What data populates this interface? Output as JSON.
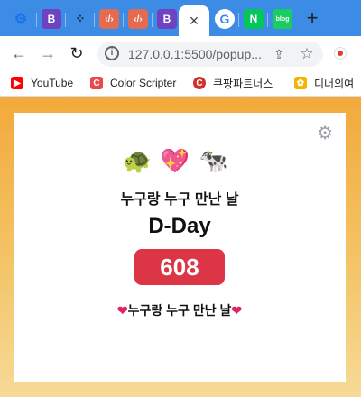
{
  "browser": {
    "tab_labels": [
      "B",
      "B"
    ],
    "active_tab_close": "×",
    "new_tab": "+",
    "address": "127.0.0.1:5500/popup...",
    "bookmarks": [
      "YouTube",
      "Color Scripter",
      "쿠팡파트너스",
      "디너의여"
    ]
  },
  "app": {
    "emojis": "🐢💖🐄",
    "title": "누구랑 누구 만난 날",
    "heading": "D-Day",
    "count": "608",
    "subtitle": "누구랑 누구 만난 날",
    "heart": "❤"
  },
  "colors": {
    "tab_bar": "#3c8ce6",
    "count_bg": "#dc3545",
    "page_gradient_top": "#f2a93b",
    "page_gradient_bottom": "#f6da96"
  }
}
